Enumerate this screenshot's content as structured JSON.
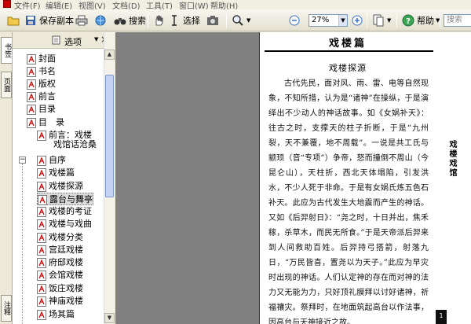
{
  "menubar": {
    "items": [
      "文件(F)",
      "编辑(E)",
      "视图(V)",
      "文档(D)",
      "工具(T)",
      "窗口(W)",
      "帮助(H)"
    ]
  },
  "toolbar": {
    "save_copy_label": "保存副本",
    "search_label": "搜索",
    "select_label": "选择",
    "zoom_value": "27%",
    "help_label": "帮助",
    "search_placeholder": "搜索"
  },
  "side_tabs": {
    "bookmarks": "书签",
    "pages": "页面",
    "comments": "注释"
  },
  "panel": {
    "options_label": "选项",
    "close_glyph": "×"
  },
  "bookmarks": [
    {
      "label": "封面"
    },
    {
      "label": "书名"
    },
    {
      "label": "版权"
    },
    {
      "label": "前言"
    },
    {
      "label": "目录"
    },
    {
      "label": "目　录"
    },
    {
      "label": "前言：戏楼"
    },
    {
      "label": "戏馆话沧桑"
    },
    {
      "label": "自序"
    },
    {
      "label": "戏楼篇"
    },
    {
      "label": "戏楼探源"
    },
    {
      "label": "露台与舞亭"
    },
    {
      "label": "戏楼的考证"
    },
    {
      "label": "戏楼与戏曲"
    },
    {
      "label": "戏楼分类"
    },
    {
      "label": "宫廷戏楼"
    },
    {
      "label": "府邸戏楼"
    },
    {
      "label": "会馆戏楼"
    },
    {
      "label": "饭庄戏楼"
    },
    {
      "label": "神庙戏楼"
    },
    {
      "label": "场其篇"
    }
  ],
  "document": {
    "title": "戏楼篇",
    "subtitle": "戏楼探源",
    "body": "古代先民，面对风、雨、雷、电等自然现象，不知所措，认为是“诸神”在操纵，于是演绎出不少动人的神话故事。如《女娲补天》：往古之时，支撑天的柱子折断，于是“九州裂，天不兼覆，地不周载”。一说是共工氏与颛顼（音“专项”）争帝，怒而撞倒不周山（今昆仑山），天柱折，西北天体塌陷，引发洪水，不少人死于非命。于是有女娲氏炼五色石补天。此应为古代发生大地震而产生的神话。又如《后羿射日》：“尧之时，十日并出，焦禾稼，杀草木，而民无所食。”于是天帝派后羿来到人间救助百姓。后羿持弓搭箭，射落九日，“万民皆喜，置尧以为天子。”此应为早灾时出现的神话。人们认定神的存在而对神的法力又无能为力，只好顶礼膜拜以讨好诸神，祈福禳灾。祭拜时，在地面筑起高台以作法事，因高台与天神接近之故。",
    "side_text": "戏楼戏馆",
    "page_marker": "1"
  },
  "colors": {
    "selected_bookmark_bg": "#dcdcdc",
    "doc_background": "#808080",
    "scroll_thumb": "#c4d3f0"
  }
}
